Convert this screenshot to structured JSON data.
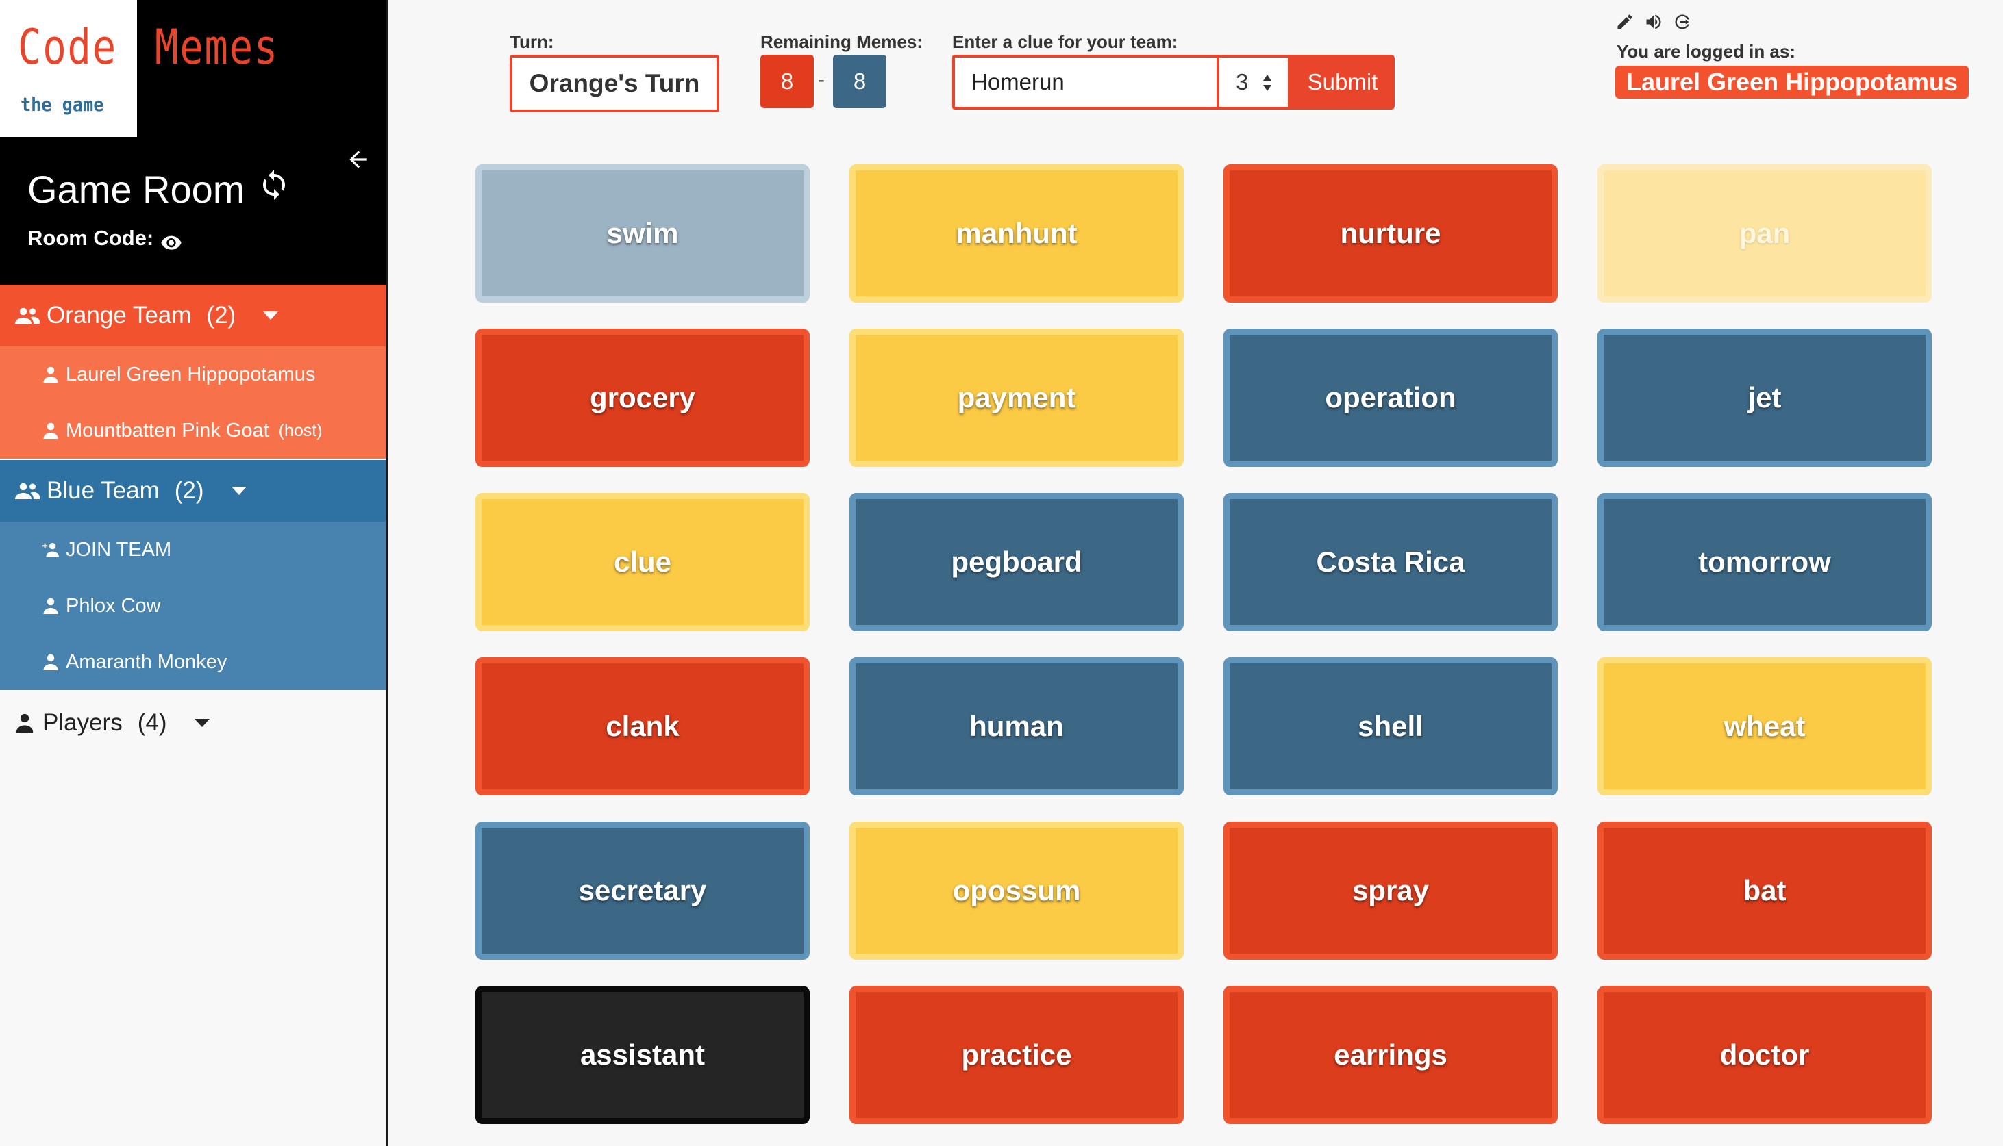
{
  "logo": {
    "word1": "Code",
    "word2": "Memes",
    "subtitle": "the game"
  },
  "sidebar": {
    "room_title": "Game Room",
    "room_code_label": "Room Code:",
    "orange_team": {
      "name": "Orange Team",
      "count": "(2)",
      "members": [
        {
          "name": "Laurel Green Hippopotamus",
          "tag": ""
        },
        {
          "name": "Mountbatten Pink Goat",
          "tag": "(host)"
        }
      ]
    },
    "blue_team": {
      "name": "Blue Team",
      "count": "(2)",
      "join_label": "JOIN TEAM",
      "members": [
        {
          "name": "Phlox Cow"
        },
        {
          "name": "Amaranth Monkey"
        }
      ]
    },
    "players": {
      "name": "Players",
      "count": "(4)"
    }
  },
  "header": {
    "turn_label": "Turn:",
    "turn_value": "Orange's Turn",
    "remaining_label": "Remaining Memes:",
    "orange_remaining": "8",
    "separator": "-",
    "blue_remaining": "8",
    "clue_label": "Enter a clue for your team:",
    "clue_value": "Homerun",
    "clue_count": "3",
    "submit_label": "Submit",
    "logged_label": "You are logged in as:",
    "user_name": "Laurel Green Hippopotamus"
  },
  "colors": {
    "orange": "#e8452b",
    "blue": "#3c6886",
    "yellow": "#fccb46",
    "neutral": "#9cb3c3",
    "assassin": "#252525"
  },
  "board": [
    {
      "word": "swim",
      "color": "grey"
    },
    {
      "word": "manhunt",
      "color": "yellow"
    },
    {
      "word": "nurture",
      "color": "red"
    },
    {
      "word": "pan",
      "color": "paleyellow"
    },
    {
      "word": "grocery",
      "color": "red"
    },
    {
      "word": "payment",
      "color": "yellow"
    },
    {
      "word": "operation",
      "color": "blue"
    },
    {
      "word": "jet",
      "color": "blue"
    },
    {
      "word": "clue",
      "color": "yellow"
    },
    {
      "word": "pegboard",
      "color": "blue"
    },
    {
      "word": "Costa Rica",
      "color": "blue"
    },
    {
      "word": "tomorrow",
      "color": "blue"
    },
    {
      "word": "clank",
      "color": "red"
    },
    {
      "word": "human",
      "color": "blue"
    },
    {
      "word": "shell",
      "color": "blue"
    },
    {
      "word": "wheat",
      "color": "yellow"
    },
    {
      "word": "secretary",
      "color": "blue"
    },
    {
      "word": "opossum",
      "color": "yellow"
    },
    {
      "word": "spray",
      "color": "red"
    },
    {
      "word": "bat",
      "color": "red"
    },
    {
      "word": "assistant",
      "color": "black"
    },
    {
      "word": "practice",
      "color": "red"
    },
    {
      "word": "earrings",
      "color": "red"
    },
    {
      "word": "doctor",
      "color": "red"
    }
  ]
}
